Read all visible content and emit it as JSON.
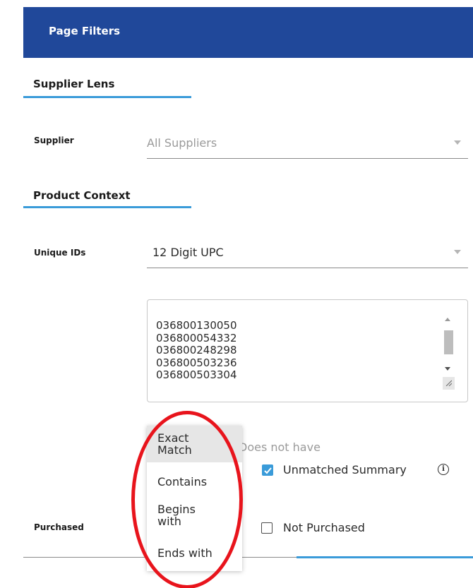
{
  "header": {
    "title": "Page Filters"
  },
  "sections": {
    "supplier_lens": "Supplier Lens",
    "product_context": "Product Context"
  },
  "supplier": {
    "label": "Supplier",
    "value": "All Suppliers"
  },
  "unique_ids": {
    "label": "Unique IDs",
    "value": "12 Digit UPC",
    "codes": [
      "036800130050",
      "036800054332",
      "036800248298",
      "036800503236",
      "036800503304"
    ]
  },
  "match_menu": {
    "items": [
      "Exact Match",
      "Contains",
      "Begins with",
      "Ends with"
    ],
    "selected": "Exact Match"
  },
  "does_not_have": "Does not have",
  "unmatched_summary": {
    "label": "Unmatched Summary",
    "checked": true
  },
  "purchased": {
    "label": "Purchased"
  },
  "not_purchased": {
    "label": "Not Purchased",
    "checked": false
  },
  "colors": {
    "header_bg": "#20489a",
    "accent": "#3a9bd9",
    "annotation": "#e8141c"
  },
  "icons": {
    "caret": "chevron-down-icon",
    "info": "info-icon",
    "check": "check-icon",
    "resize": "resize-grip-icon"
  }
}
